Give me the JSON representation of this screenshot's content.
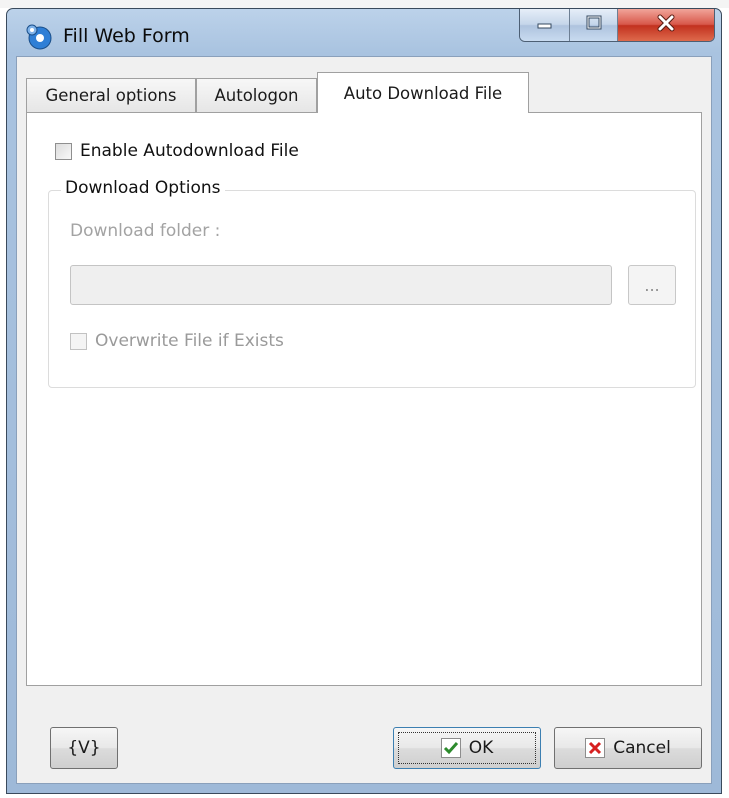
{
  "window": {
    "title": "Fill Web Form",
    "controls": {
      "minimize_icon": "minimize-icon",
      "maximize_icon": "maximize-icon",
      "close_icon": "close-icon"
    }
  },
  "tabs": [
    {
      "label": "General options",
      "active": false
    },
    {
      "label": "Autologon",
      "active": false
    },
    {
      "label": "Auto Download File",
      "active": true
    }
  ],
  "panel": {
    "enable_autodownload": {
      "label": "Enable Autodownload File",
      "checked": false
    },
    "download_options": {
      "title": "Download Options",
      "download_folder_label": "Download folder :",
      "download_folder_value": "",
      "browse_label": "...",
      "overwrite": {
        "label": "Overwrite File if Exists",
        "checked": false,
        "enabled": false
      }
    }
  },
  "buttons": {
    "variables_label": "{V}",
    "ok_label": "OK",
    "cancel_label": "Cancel"
  },
  "colors": {
    "ok_check": "#2e8b2e",
    "cancel_x": "#d62020"
  }
}
